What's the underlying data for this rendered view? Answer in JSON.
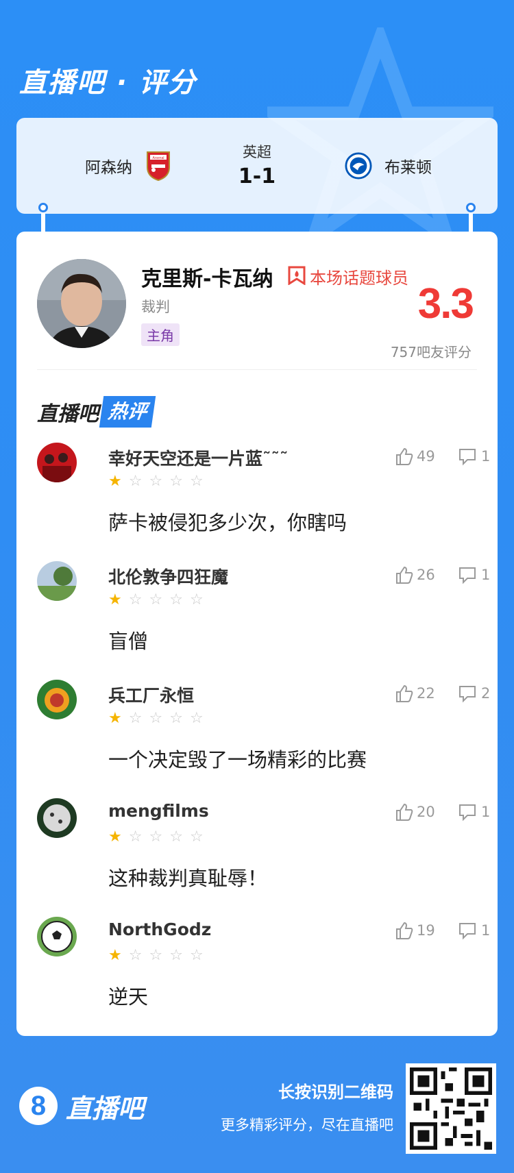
{
  "header": {
    "title": "直播吧 · 评分"
  },
  "match": {
    "home_team": "阿森纳",
    "away_team": "布莱顿",
    "league": "英超",
    "score": "1-1",
    "home_crest_text": "Arsenal"
  },
  "player": {
    "name": "克里斯-卡瓦纳",
    "hot_tag": "本场话题球员",
    "role": "裁判",
    "badge": "主角",
    "rating": "3.3",
    "rating_count": "757吧友评分"
  },
  "hot_comments": {
    "brand": "直播吧",
    "badge": "热评",
    "items": [
      {
        "user": "幸好天空还是一片蓝˜˜˜",
        "rating": 1,
        "text": "萨卡被侵犯多少次，你瞎吗",
        "likes": "49",
        "replies": "1"
      },
      {
        "user": "北伦敦争四狂魔",
        "rating": 1,
        "text": "盲僧",
        "likes": "26",
        "replies": "1"
      },
      {
        "user": "兵工厂永恒",
        "rating": 1,
        "text": "一个决定毁了一场精彩的比赛",
        "likes": "22",
        "replies": "2"
      },
      {
        "user": "mengfilms",
        "rating": 1,
        "text": "这种裁判真耻辱！",
        "likes": "20",
        "replies": "1"
      },
      {
        "user": "NorthGodz",
        "rating": 1,
        "text": "逆天",
        "likes": "19",
        "replies": "1"
      }
    ]
  },
  "footer": {
    "logo_mark": "8",
    "logo_text": "直播吧",
    "qr_title": "长按识别二维码",
    "qr_subtitle": "更多精彩评分，尽在直播吧"
  },
  "colors": {
    "brand_blue": "#2a84ef",
    "rating_red": "#ef3a36",
    "star_gold": "#f5b400"
  }
}
